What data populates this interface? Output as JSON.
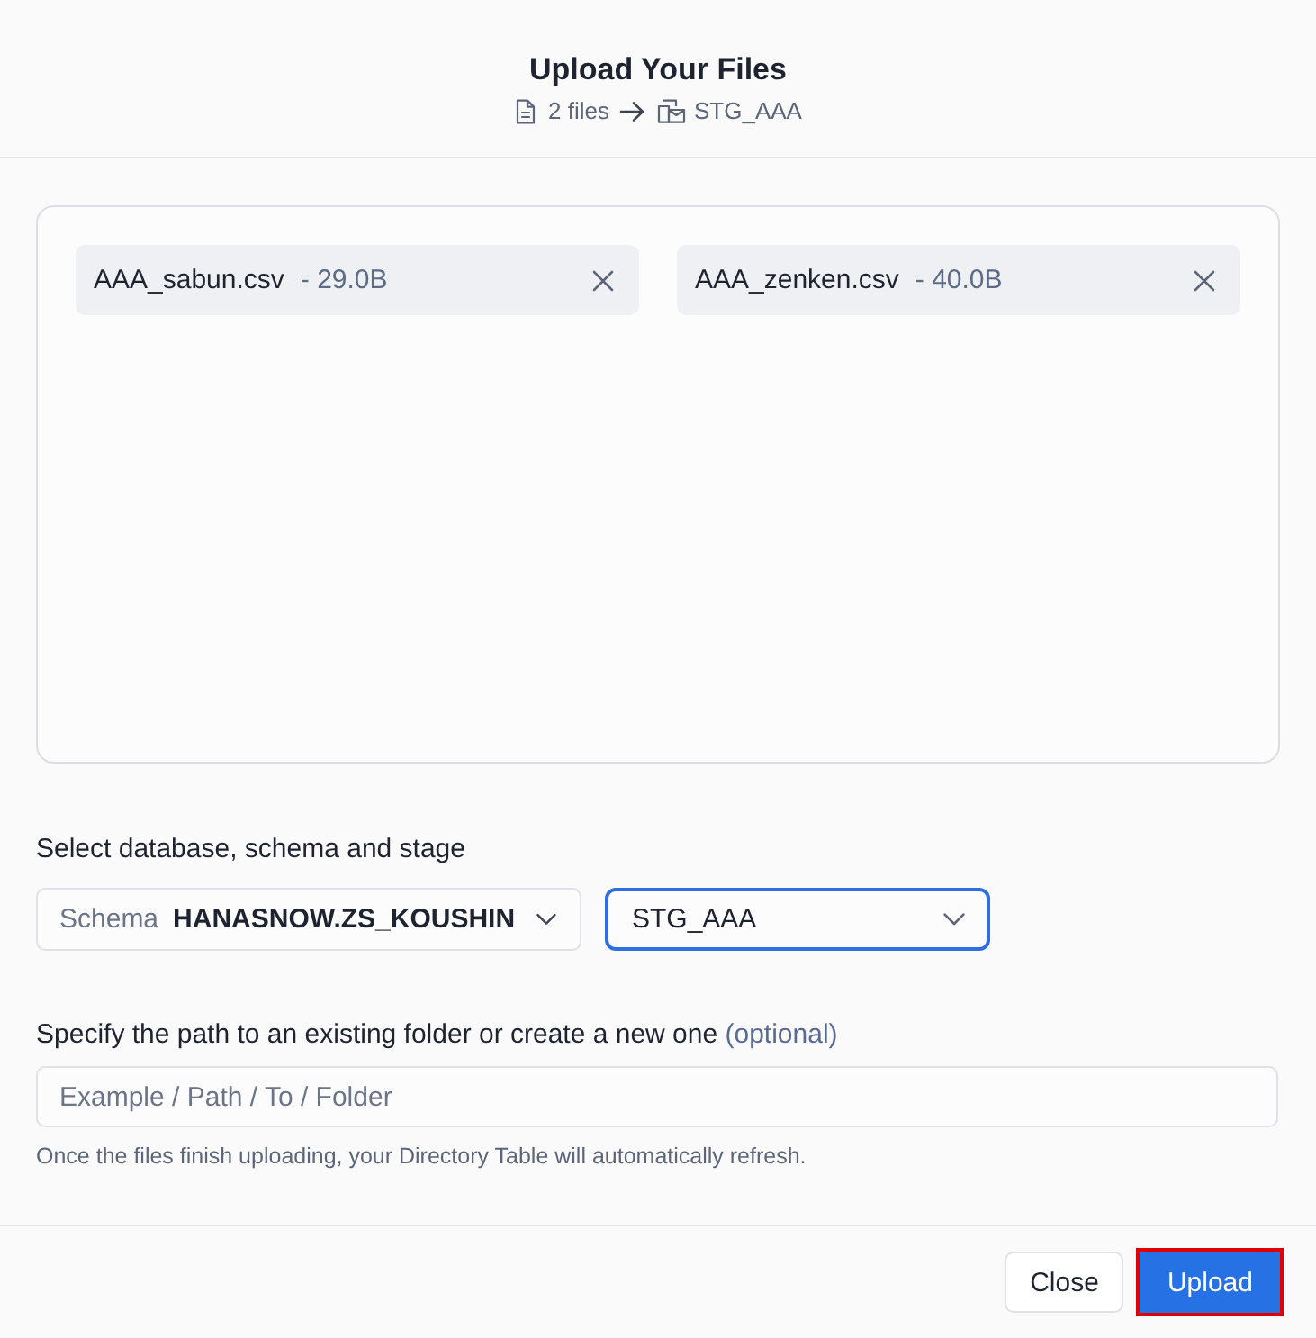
{
  "dialog": {
    "title": "Upload Your Files",
    "summary": {
      "file_count": "2 files",
      "target": "STG_AAA"
    }
  },
  "files": [
    {
      "name": "AAA_sabun.csv",
      "size": "- 29.0B"
    },
    {
      "name": "AAA_zenken.csv",
      "size": "- 40.0B"
    }
  ],
  "location": {
    "label": "Select database, schema and stage",
    "schema_select": {
      "prefix": "Schema",
      "value": "HANASNOW.ZS_KOUSHIN",
      "focused": false
    },
    "stage_select": {
      "value": "STG_AAA",
      "focused": true
    }
  },
  "path": {
    "label": "Specify the path to an existing folder or create a new one",
    "optional_note": "(optional)",
    "placeholder": "Example / Path / To / Folder",
    "hint": "Once the files finish uploading, your Directory Table will automatically refresh."
  },
  "buttons": [
    {
      "label": "Close",
      "kind": "secondary",
      "highlighted": false
    },
    {
      "label": "Upload",
      "kind": "primary",
      "highlighted": true
    }
  ]
}
